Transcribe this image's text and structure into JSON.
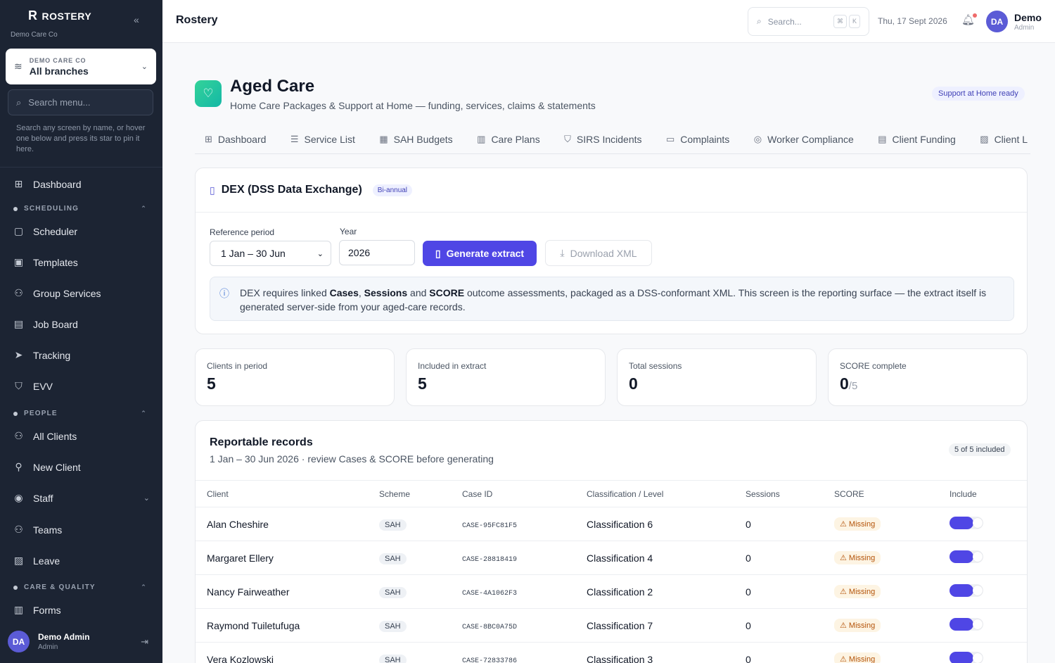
{
  "sidebar": {
    "brand": "ROSTERY",
    "org_label": "Demo Care Co",
    "branch_org": "DEMO CARE CO",
    "branch_name": "All branches",
    "search_placeholder": "Search menu...",
    "hint": "Search any screen by name, or hover one below and press its star to pin it here.",
    "items": {
      "dashboard": "Dashboard",
      "scheduling": "SCHEDULING",
      "scheduler": "Scheduler",
      "templates": "Templates",
      "group_services": "Group Services",
      "job_board": "Job Board",
      "tracking": "Tracking",
      "evv": "EVV",
      "people": "PEOPLE",
      "all_clients": "All Clients",
      "new_client": "New Client",
      "staff": "Staff",
      "teams": "Teams",
      "leave": "Leave",
      "care_quality": "CARE & QUALITY",
      "forms": "Forms"
    },
    "user": {
      "initials": "DA",
      "name": "Demo Admin",
      "role": "Admin"
    }
  },
  "topbar": {
    "app_name": "Rostery",
    "search_placeholder": "Search...",
    "kbd_1": "⌘",
    "kbd_2": "K",
    "date": "Thu, 17 Sept 2026",
    "user_initials": "DA",
    "user_name": "Demo",
    "user_role": "Admin"
  },
  "page": {
    "title": "Aged Care",
    "subtitle": "Home Care Packages & Support at Home — funding, services, claims & statements",
    "badge": "Support at Home ready",
    "tabs": [
      "Dashboard",
      "Service List",
      "SAH Budgets",
      "Care Plans",
      "SIRS Incidents",
      "Complaints",
      "Worker Compliance",
      "Client Funding",
      "Client L"
    ]
  },
  "dex": {
    "title": "DEX (DSS Data Exchange)",
    "badge": "Bi-annual",
    "period_label": "Reference period",
    "period_value": "1 Jan – 30 Jun",
    "year_label": "Year",
    "year_value": "2026",
    "generate_label": "Generate extract",
    "download_label": "Download XML",
    "info_1": "DEX requires linked ",
    "info_cases": "Cases",
    "info_2": ", ",
    "info_sessions": "Sessions",
    "info_3": " and ",
    "info_score": "SCORE",
    "info_4": " outcome assessments, packaged as a DSS-conformant XML. This screen is the reporting surface — the extract itself is generated server-side from your aged-care records."
  },
  "stats": [
    {
      "label": "Clients in period",
      "value": "5",
      "denominator": ""
    },
    {
      "label": "Included in extract",
      "value": "5",
      "denominator": ""
    },
    {
      "label": "Total sessions",
      "value": "0",
      "denominator": ""
    },
    {
      "label": "SCORE complete",
      "value": "0",
      "denominator": "/5"
    }
  ],
  "records": {
    "title": "Reportable records",
    "subtitle": "1 Jan – 30 Jun 2026 · review Cases & SCORE before generating",
    "badge": "5 of 5 included",
    "columns": [
      "Client",
      "Scheme",
      "Case ID",
      "Classification / Level",
      "Sessions",
      "SCORE",
      "Include"
    ],
    "rows": [
      {
        "client": "Alan Cheshire",
        "scheme": "SAH",
        "case_id": "CASE-95FC81F5",
        "classification": "Classification 6",
        "sessions": "0",
        "score": "Missing",
        "include": true
      },
      {
        "client": "Margaret Ellery",
        "scheme": "SAH",
        "case_id": "CASE-28818419",
        "classification": "Classification 4",
        "sessions": "0",
        "score": "Missing",
        "include": true
      },
      {
        "client": "Nancy Fairweather",
        "scheme": "SAH",
        "case_id": "CASE-4A1062F3",
        "classification": "Classification 2",
        "sessions": "0",
        "score": "Missing",
        "include": true
      },
      {
        "client": "Raymond Tuiletufuga",
        "scheme": "SAH",
        "case_id": "CASE-8BC0A75D",
        "classification": "Classification 7",
        "sessions": "0",
        "score": "Missing",
        "include": true
      },
      {
        "client": "Vera Kozlowski",
        "scheme": "SAH",
        "case_id": "CASE-72833786",
        "classification": "Classification 3",
        "sessions": "0",
        "score": "Missing",
        "include": true
      }
    ]
  },
  "colors": {
    "sidebar_bg": "#1c2433",
    "accent": "#4f46e5",
    "missing": "#b45309",
    "teal": "#14b8a6"
  }
}
